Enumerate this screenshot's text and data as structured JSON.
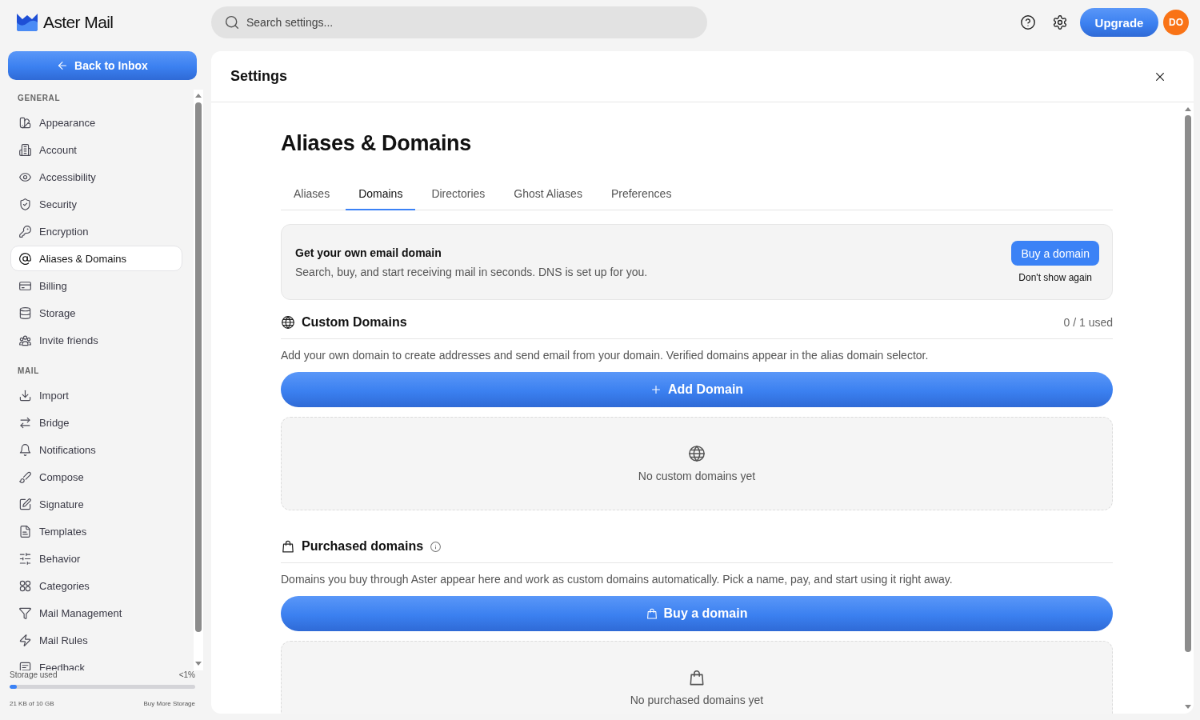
{
  "app": {
    "name": "Aster Mail"
  },
  "search": {
    "placeholder": "Search settings..."
  },
  "topbar": {
    "upgrade_button": "Upgrade",
    "avatar": "DO"
  },
  "sidebar": {
    "back_button": "Back to Inbox",
    "sections": [
      {
        "label": "GENERAL",
        "items": [
          {
            "label": "Appearance",
            "selected": false
          },
          {
            "label": "Account",
            "selected": false
          },
          {
            "label": "Accessibility",
            "selected": false
          },
          {
            "label": "Security",
            "selected": false
          },
          {
            "label": "Encryption",
            "selected": false
          },
          {
            "label": "Aliases & Domains",
            "selected": true
          },
          {
            "label": "Billing",
            "selected": false
          },
          {
            "label": "Storage",
            "selected": false
          },
          {
            "label": "Invite friends",
            "selected": false
          }
        ]
      },
      {
        "label": "MAIL",
        "items": [
          {
            "label": "Import",
            "selected": false
          },
          {
            "label": "Bridge",
            "selected": false
          },
          {
            "label": "Notifications",
            "selected": false
          },
          {
            "label": "Compose",
            "selected": false
          },
          {
            "label": "Signature",
            "selected": false
          },
          {
            "label": "Templates",
            "selected": false
          },
          {
            "label": "Behavior",
            "selected": false
          },
          {
            "label": "Categories",
            "selected": false
          },
          {
            "label": "Mail Management",
            "selected": false
          },
          {
            "label": "Mail Rules",
            "selected": false
          },
          {
            "label": "Feedback",
            "selected": false
          }
        ]
      }
    ],
    "storage": {
      "label": "Storage used",
      "percent": "<1%",
      "level": 0.04,
      "usage": "21 KB of 10 GB",
      "link": "Buy More Storage"
    }
  },
  "settings": {
    "title": "Settings",
    "page_title": "Aliases & Domains",
    "tabs": [
      {
        "label": "Aliases",
        "selected": false
      },
      {
        "label": "Domains",
        "selected": true
      },
      {
        "label": "Directories",
        "selected": false
      },
      {
        "label": "Ghost Aliases",
        "selected": false
      },
      {
        "label": "Preferences",
        "selected": false
      }
    ],
    "promo": {
      "title": "Get your own email domain",
      "description": "Search, buy, and start receiving mail in seconds. DNS is set up for you.",
      "button": "Buy a domain",
      "dismiss": "Don't show again"
    },
    "sections": [
      {
        "kind": "custom",
        "title": "Custom Domains",
        "usage": "0 / 1 used",
        "description": "Add your own domain to create addresses and send email from your domain. Verified domains appear in the alias domain selector.",
        "button": "Add Domain",
        "empty_text": "No custom domains yet"
      },
      {
        "kind": "purchased",
        "title": "Purchased domains",
        "description": "Domains you buy through Aster appear here and work as custom domains automatically. Pick a name, pay, and start using it right away.",
        "button": "Buy a domain",
        "empty_text": "No purchased domains yet"
      }
    ]
  }
}
